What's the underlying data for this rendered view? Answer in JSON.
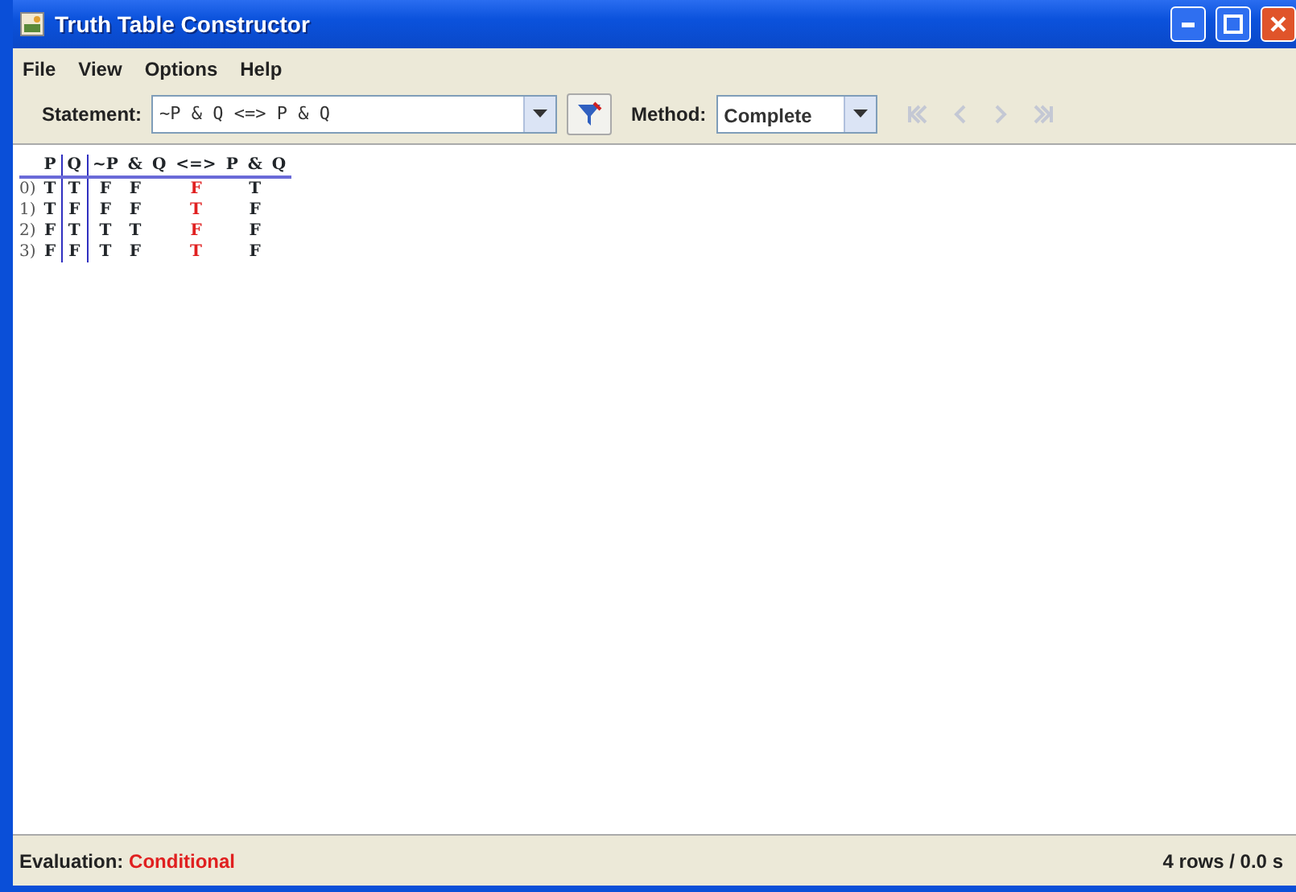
{
  "window": {
    "title": "Truth Table Constructor"
  },
  "menu": [
    "File",
    "View",
    "Options",
    "Help"
  ],
  "toolbar": {
    "statement_label": "Statement:",
    "statement": "~P & Q <=> P & Q",
    "method_label": "Method:",
    "method": "Complete",
    "nav_disabled": true
  },
  "table": {
    "variables": [
      "P",
      "Q"
    ],
    "expression": [
      {
        "text": "~P",
        "kind": "valued"
      },
      {
        "text": "&",
        "kind": "valued"
      },
      {
        "text": "Q",
        "kind": "plain"
      },
      {
        "text": "<=>",
        "kind": "valued"
      },
      {
        "text": "P",
        "kind": "plain"
      },
      {
        "text": "&",
        "kind": "valued"
      },
      {
        "text": "Q",
        "kind": "plain"
      }
    ],
    "rows": [
      {
        "label": "0)",
        "vars": [
          "T",
          "T"
        ],
        "values": [
          {
            "text": "F",
            "kind": "sub"
          },
          {
            "text": "F",
            "kind": "sub"
          },
          {
            "text": "F",
            "kind": "main"
          },
          {
            "text": "T",
            "kind": "sub"
          }
        ]
      },
      {
        "label": "1)",
        "vars": [
          "T",
          "F"
        ],
        "values": [
          {
            "text": "F",
            "kind": "sub"
          },
          {
            "text": "F",
            "kind": "sub"
          },
          {
            "text": "T",
            "kind": "main"
          },
          {
            "text": "F",
            "kind": "sub"
          }
        ]
      },
      {
        "label": "2)",
        "vars": [
          "F",
          "T"
        ],
        "values": [
          {
            "text": "T",
            "kind": "sub"
          },
          {
            "text": "T",
            "kind": "sub"
          },
          {
            "text": "F",
            "kind": "main"
          },
          {
            "text": "F",
            "kind": "sub"
          }
        ]
      },
      {
        "label": "3)",
        "vars": [
          "F",
          "F"
        ],
        "values": [
          {
            "text": "T",
            "kind": "sub"
          },
          {
            "text": "F",
            "kind": "sub"
          },
          {
            "text": "T",
            "kind": "main"
          },
          {
            "text": "F",
            "kind": "sub"
          }
        ]
      }
    ]
  },
  "status_bar": {
    "label": "Evaluation:",
    "evaluation": "Conditional",
    "summary": "4 rows / 0.0 s"
  }
}
